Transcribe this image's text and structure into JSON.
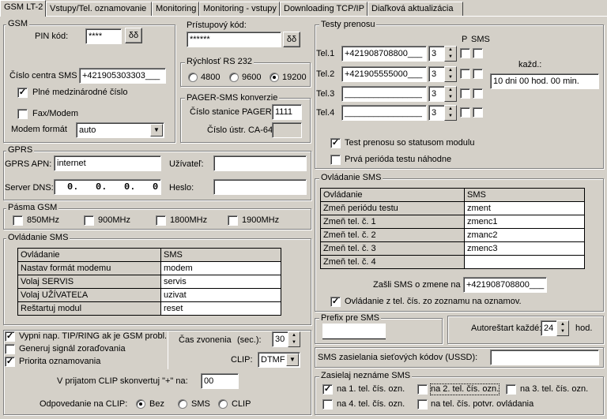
{
  "tabs": [
    "GSM LT-2",
    "Vstupy/Tel. oznamovanie",
    "Monitoring",
    "Monitoring - vstupy",
    "Downloading TCP/IP",
    "Diaľková aktualizácia"
  ],
  "gsm": {
    "title": "GSM",
    "pin_label": "PIN kód:",
    "pin_value": "****",
    "sms_center_label": "Číslo centra SMS",
    "sms_center_value": "+421905303303___",
    "full_intl_label": "Plné medzinárodné číslo",
    "fax_label": "Fax/Modem",
    "modem_format_label": "Modem formát",
    "modem_format_value": "auto"
  },
  "access": {
    "title": "Prístupový kód:",
    "value": "******"
  },
  "rs232": {
    "title": "Rýchlosť RS 232",
    "options": [
      "4800",
      "9600",
      "19200"
    ]
  },
  "pager": {
    "title": "PAGER-SMS konverzie",
    "station_label": "Číslo stanice PAGER:",
    "station_value": "1111",
    "ca64_label": "Číslo ústr. CA-64:",
    "ca64_value": ""
  },
  "tests": {
    "title": "Testy prenosu",
    "p_label": "P",
    "sms_label": "SMS",
    "kazd_label": "každ.:",
    "kazd_value": "10 dni 00 hod. 00 min.",
    "rows": [
      {
        "label": "Tel.1",
        "number": "+421908708800___",
        "count": "3"
      },
      {
        "label": "Tel.2",
        "number": "+421905555000___",
        "count": "3"
      },
      {
        "label": "Tel.3",
        "number": "________________",
        "count": "3"
      },
      {
        "label": "Tel.4",
        "number": "________________",
        "count": "3"
      }
    ],
    "status_label": "Test prenosu so statusom modulu",
    "random_label": "Prvá perióda testu náhodne"
  },
  "gprs": {
    "title": "GPRS",
    "apn_label": "GPRS APN:",
    "apn_value": "internet",
    "user_label": "Užívateľ:",
    "user_value": "",
    "dns_label": "Server DNS:",
    "dns_value": "0.   0.   0.   0",
    "pass_label": "Heslo:",
    "pass_value": ""
  },
  "bands": {
    "title": "Pásma GSM",
    "items": [
      "850MHz",
      "900MHz",
      "1800MHz",
      "1900MHz"
    ]
  },
  "sms_left": {
    "title": "Ovládanie SMS",
    "col1": "Ovládanie",
    "col2": "SMS",
    "rows": [
      [
        "Nastav formát modemu",
        "modem"
      ],
      [
        "Volaj SERVIS",
        "servis"
      ],
      [
        "Volaj UŽÍVATEĽA",
        "uzivat"
      ],
      [
        "Reštartuj modul",
        "reset"
      ]
    ]
  },
  "sms_right": {
    "title": "Ovládanie SMS",
    "col1": "Ovládanie",
    "col2": "SMS",
    "rows": [
      [
        "Zmeň periódu testu",
        "zment"
      ],
      [
        "Zmeň tel. č. 1",
        "zmenc1"
      ],
      [
        "Zmeň tel. č. 2",
        "zmanc2"
      ],
      [
        "Zmeň tel. č. 3",
        "zmenc3"
      ],
      [
        "Zmeň tel. č. 4",
        ""
      ]
    ],
    "notify_label": "Zašli SMS o zmene na",
    "notify_value": "+421908708800___",
    "from_list_label": "Ovládanie z tel. čís. zo zoznamu na oznamov."
  },
  "bottom_left": {
    "tip_ring_label": "Vypni nap. TIP/RING ak je GSM probl.",
    "gen_signal_label": "Generuj signál zoraďovania",
    "priority_label": "Priorita oznamovania",
    "ring_time_label": "Čas zvonenia",
    "sec_label": "(sec.):",
    "ring_time_value": "30",
    "clip_label": "CLIP:",
    "clip_value": "DTMF",
    "convert_label": "V prijatom CLIP skonvertuj \"+\" na:",
    "convert_value": "00",
    "answer_label": "Odpovedanie na CLIP:",
    "answer_options": [
      "Bez",
      "SMS",
      "CLIP"
    ]
  },
  "prefix": {
    "title": "Prefix pre SMS",
    "value": ""
  },
  "autorestart": {
    "label": "Autoreštart každé:",
    "value": "24",
    "unit": "hod."
  },
  "ussd": {
    "label": "SMS zasielania sieťových kódov (USSD):",
    "value": ""
  },
  "unknown": {
    "title": "Zasielaj neznáme SMS",
    "items": [
      "na 1. tel. čís. ozn.",
      "na 2. tel. čís. ozn.",
      "na 3. tel. čís. ozn.",
      "na 4. tel. čís. ozn.",
      "na tel. čís. potvr. ovládania"
    ]
  }
}
